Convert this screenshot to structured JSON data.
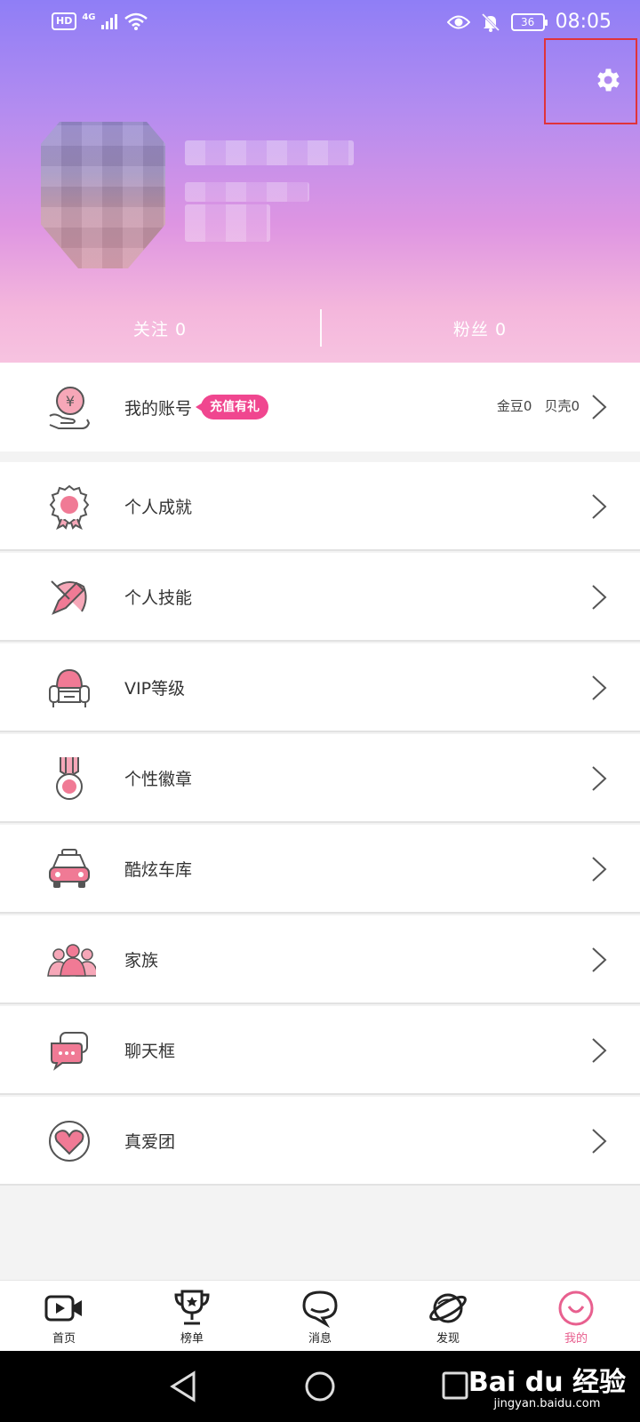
{
  "status_bar": {
    "hd": "HD",
    "network": "4G",
    "time": "08:05",
    "battery": "36"
  },
  "header": {
    "settings_icon": "gear-icon"
  },
  "follow": {
    "following": "关注 0",
    "fans": "粉丝 0"
  },
  "account": {
    "label": "我的账号",
    "tag": "充值有礼",
    "gold": "金豆0",
    "shell": "贝壳0"
  },
  "menu": [
    {
      "label": "个人成就",
      "icon": "award-badge-icon"
    },
    {
      "label": "个人技能",
      "icon": "skill-pencil-icon"
    },
    {
      "label": "VIP等级",
      "icon": "vip-sofa-icon"
    },
    {
      "label": "个性徽章",
      "icon": "medal-icon"
    },
    {
      "label": "酷炫车库",
      "icon": "car-icon"
    },
    {
      "label": "家族",
      "icon": "family-icon"
    },
    {
      "label": "聊天框",
      "icon": "chat-bubble-icon"
    },
    {
      "label": "真爱团",
      "icon": "heart-icon"
    }
  ],
  "tabs": [
    {
      "label": "首页",
      "icon": "video-camera-icon"
    },
    {
      "label": "榜单",
      "icon": "trophy-icon"
    },
    {
      "label": "消息",
      "icon": "message-icon"
    },
    {
      "label": "发现",
      "icon": "planet-icon"
    },
    {
      "label": "我的",
      "icon": "smile-icon",
      "active": true
    }
  ],
  "watermark": {
    "brand": "Bai du 经验",
    "url": "jingyan.baidu.com"
  },
  "colors": {
    "accent_pink": "#f0468f",
    "active_tab": "#e8608f",
    "settings_highlight": "#e0333a"
  }
}
